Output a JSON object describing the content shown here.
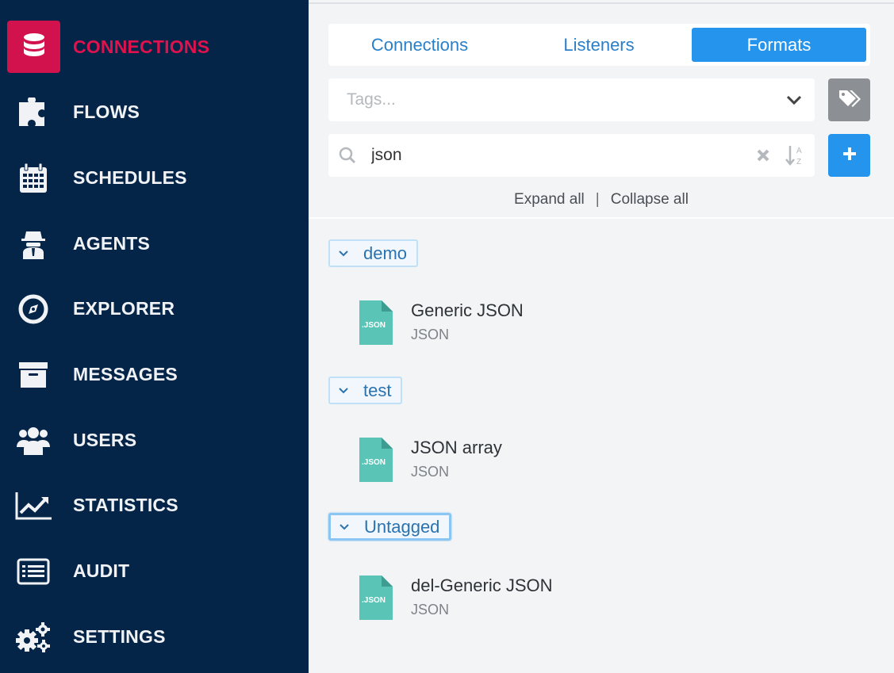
{
  "sidebar": {
    "items": [
      {
        "label": "CONNECTIONS",
        "icon": "database-icon"
      },
      {
        "label": "FLOWS",
        "icon": "puzzle-icon"
      },
      {
        "label": "SCHEDULES",
        "icon": "calendar-icon"
      },
      {
        "label": "AGENTS",
        "icon": "agent-icon"
      },
      {
        "label": "EXPLORER",
        "icon": "compass-icon"
      },
      {
        "label": "MESSAGES",
        "icon": "archive-icon"
      },
      {
        "label": "USERS",
        "icon": "users-icon"
      },
      {
        "label": "STATISTICS",
        "icon": "line-chart-icon"
      },
      {
        "label": "AUDIT",
        "icon": "list-icon"
      },
      {
        "label": "SETTINGS",
        "icon": "gears-icon"
      }
    ],
    "active_color": "#d2124d",
    "background": "#042548"
  },
  "tabs": [
    {
      "label": "Connections"
    },
    {
      "label": "Listeners"
    },
    {
      "label": "Formats"
    }
  ],
  "active_tab": "Formats",
  "tags": {
    "placeholder": "Tags..."
  },
  "search": {
    "value": "json"
  },
  "expand": {
    "expand_label": "Expand all",
    "separator": "|",
    "collapse_label": "Collapse all"
  },
  "groups": [
    {
      "label": "demo",
      "items": [
        {
          "title": "Generic JSON",
          "subtitle": "JSON",
          "badge": ".JSON"
        }
      ]
    },
    {
      "label": "test",
      "items": [
        {
          "title": "JSON array",
          "subtitle": "JSON",
          "badge": ".JSON"
        }
      ]
    },
    {
      "label": "Untagged",
      "items": [
        {
          "title": "del-Generic JSON",
          "subtitle": "JSON",
          "badge": ".JSON"
        }
      ]
    }
  ],
  "colors": {
    "accent": "#2594ec",
    "file_icon": "#5ac5b7"
  }
}
